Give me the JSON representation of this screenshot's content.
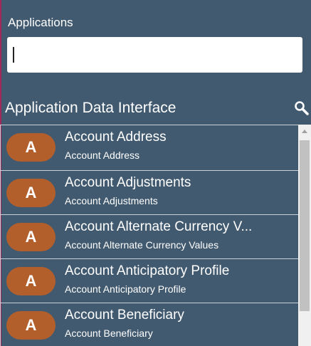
{
  "applications_field": {
    "label": "Applications",
    "value": ""
  },
  "section": {
    "title": "Application Data Interface",
    "search_icon": "search-icon"
  },
  "list": {
    "items": [
      {
        "badge": "A",
        "title": "Account Address",
        "subtitle": "Account Address"
      },
      {
        "badge": "A",
        "title": "Account Adjustments",
        "subtitle": "Account Adjustments"
      },
      {
        "badge": "A",
        "title": "Account Alternate Currency V...",
        "subtitle": "Account Alternate Currency Values"
      },
      {
        "badge": "A",
        "title": "Account Anticipatory Profile",
        "subtitle": "Account Anticipatory Profile"
      },
      {
        "badge": "A",
        "title": "Account Beneficiary",
        "subtitle": "Account Beneficiary"
      }
    ]
  },
  "colors": {
    "background": "#415a70",
    "badge": "#b35f2b",
    "accent_edge": "#a0285a"
  }
}
